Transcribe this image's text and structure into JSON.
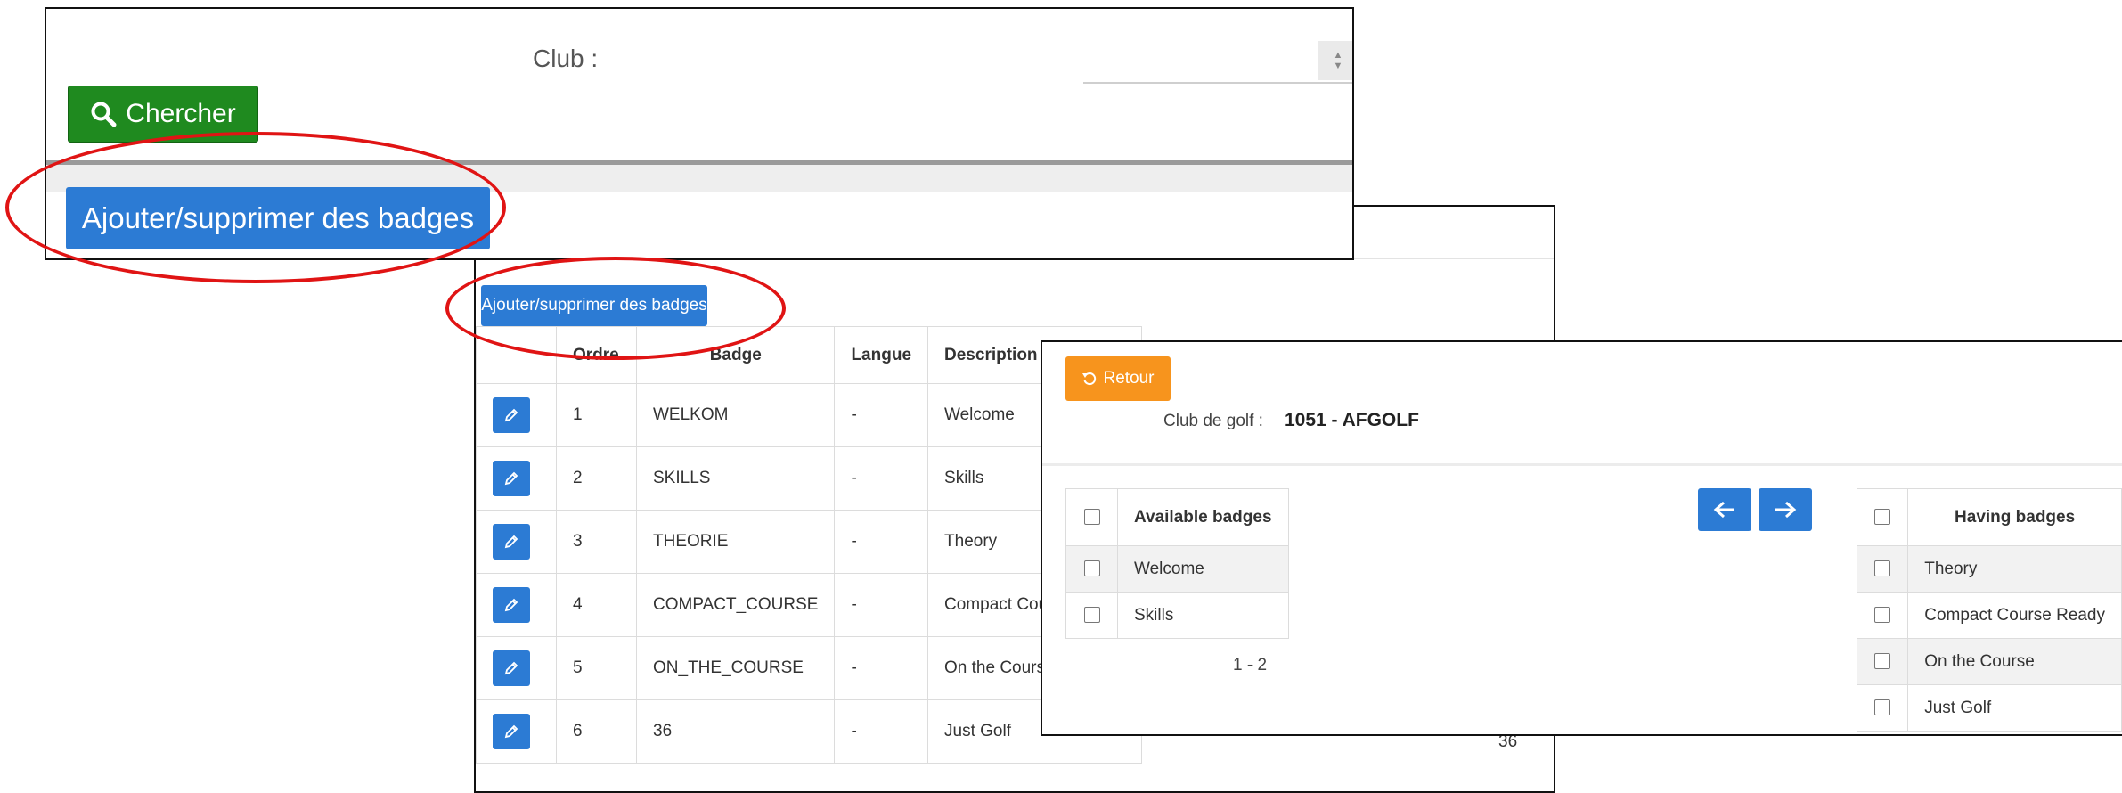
{
  "search_panel": {
    "club_label": "Club :",
    "search_button": "Chercher",
    "badges_button": "Ajouter/supprimer des badges"
  },
  "table_panel": {
    "badges_button": "Ajouter/supprimer des badges",
    "headers": [
      "",
      "Ordre",
      "Badge",
      "Langue",
      "Description"
    ],
    "rows": [
      {
        "order": "1",
        "badge": "WELKOM",
        "lang": "-",
        "desc": "Welcome"
      },
      {
        "order": "2",
        "badge": "SKILLS",
        "lang": "-",
        "desc": "Skills"
      },
      {
        "order": "3",
        "badge": "THEORIE",
        "lang": "-",
        "desc": "Theory"
      },
      {
        "order": "4",
        "badge": "COMPACT_COURSE",
        "lang": "-",
        "desc": "Compact Course"
      },
      {
        "order": "5",
        "badge": "ON_THE_COURSE",
        "lang": "-",
        "desc": "On the Course"
      },
      {
        "order": "6",
        "badge": "36",
        "lang": "-",
        "desc": "Just Golf"
      }
    ],
    "partial_right_col": "36"
  },
  "transfer_panel": {
    "back_button": "Retour",
    "club_label": "Club de golf :",
    "club_value": "1051 - AFGOLF",
    "available_header": "Available badges",
    "available": [
      "Welcome",
      "Skills"
    ],
    "pager": "1 - 2",
    "having_header": "Having badges",
    "having": [
      "Theory",
      "Compact Course Ready",
      "On the Course",
      "Just Golf"
    ]
  },
  "colors": {
    "primary": "#2c7bd4",
    "success": "#1f8a1f",
    "warning": "#f7941d",
    "highlight": "#e01414"
  }
}
